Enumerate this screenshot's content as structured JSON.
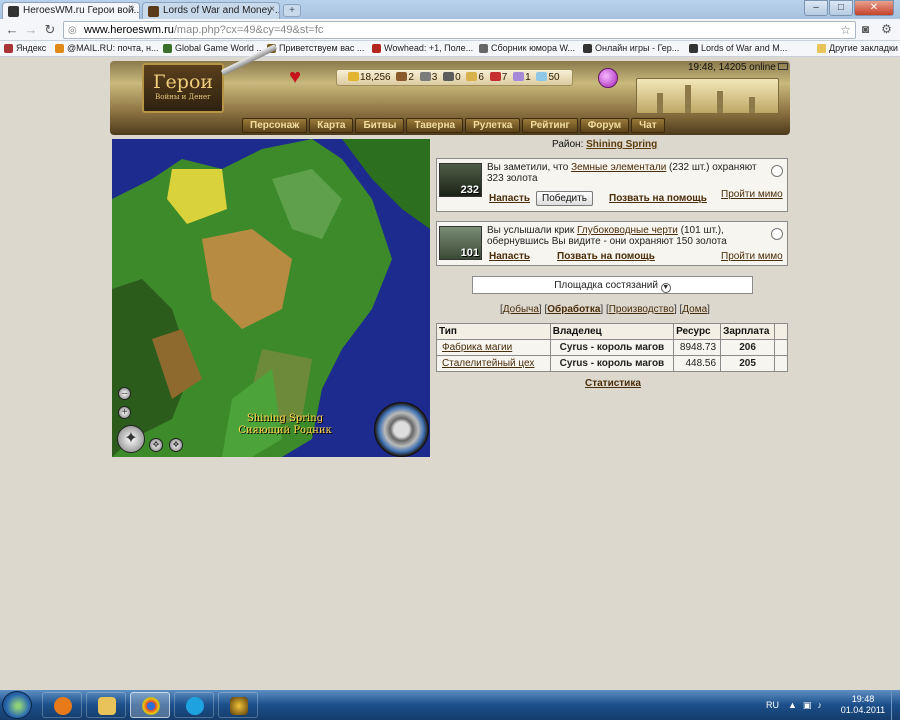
{
  "browser": {
    "tabs": [
      {
        "title": "HeroesWM.ru Герои вой...",
        "close": "×"
      },
      {
        "title": "Lords of War and Money ...",
        "close": "×"
      }
    ],
    "new_tab": "+",
    "address": {
      "domain": "www.heroeswm.ru",
      "path": "/map.php?cx=49&cy=49&st=fc"
    },
    "bookmarks": [
      "Яндекс",
      "@MAIL.RU: почта, н...",
      "Global Game World ...",
      "Приветствуем вас ...",
      "Wowhead: +1, Поле...",
      "Сборник юмора W...",
      "Онлайн игры - Гер...",
      "Lords of War and M...",
      "Другие закладки"
    ],
    "window": {
      "minimize": "–",
      "maximize": "□",
      "close": "✕"
    }
  },
  "game": {
    "online_status": "19:48, 14205 online",
    "logo_title": "Герои",
    "logo_subtitle": "Войны и Денег",
    "resources": [
      {
        "value": "18,256",
        "color": "#e2b430",
        "icon": "gold-icon"
      },
      {
        "value": "2",
        "color": "#8b5a2b",
        "icon": "wood-icon"
      },
      {
        "value": "3",
        "color": "#7c7c7c",
        "icon": "ore-icon"
      },
      {
        "value": "0",
        "color": "#5c5c5c",
        "icon": "mercury-icon"
      },
      {
        "value": "6",
        "color": "#d9b24b",
        "icon": "sulfur-icon"
      },
      {
        "value": "7",
        "color": "#c42f2f",
        "icon": "crystals-icon"
      },
      {
        "value": "1",
        "color": "#a68ad8",
        "icon": "gems-icon"
      },
      {
        "value": "50",
        "color": "#8ec8e6",
        "icon": "diamond-icon"
      }
    ],
    "menu": [
      "Персонаж",
      "Карта",
      "Битвы",
      "Таверна",
      "Рулетка",
      "Рейтинг",
      "Форум",
      "Чат"
    ],
    "map": {
      "label_en": "Shining Spring",
      "label_ru": "Сияющий Родник",
      "zoom_out": "–",
      "zoom_in": "+"
    },
    "district": {
      "label": "Район:",
      "name": "Shining Spring"
    },
    "events": [
      {
        "count": "232",
        "text_before": "Вы заметили, что ",
        "creature": "Земные элементали",
        "text_after": " (232 шт.) охраняют 323 золота",
        "attack": "Напасть",
        "win_button": "Победить",
        "call_help": "Позвать на помощь",
        "pass_by": "Пройти мимо"
      },
      {
        "count": "101",
        "text_before": "Вы услышали крик ",
        "creature": "Глубоководные черти",
        "text_after": " (101 шт.), обернувшись Вы видите - они охраняют 150 золота",
        "attack": "Напасть",
        "call_help": "Позвать на помощь",
        "pass_by": "Пройти мимо"
      }
    ],
    "arena": {
      "label": "Площадка состязаний"
    },
    "subtabs": [
      "Добыча",
      "Обработка",
      "Производство",
      "Дома"
    ],
    "table": {
      "headers": [
        "Тип",
        "Владелец",
        "Ресурс",
        "Зарплата"
      ],
      "rows": [
        {
          "type": "Фабрика магии",
          "owner": "Cyrus - король магов",
          "resource": "8948.73",
          "wage": "206"
        },
        {
          "type": "Сталелитейный цех",
          "owner": "Cyrus - король магов",
          "resource": "448.56",
          "wage": "205"
        }
      ]
    },
    "stats_link": "Статистика"
  },
  "taskbar": {
    "lang": "RU",
    "time": "19:48",
    "date": "01.04.2011"
  }
}
